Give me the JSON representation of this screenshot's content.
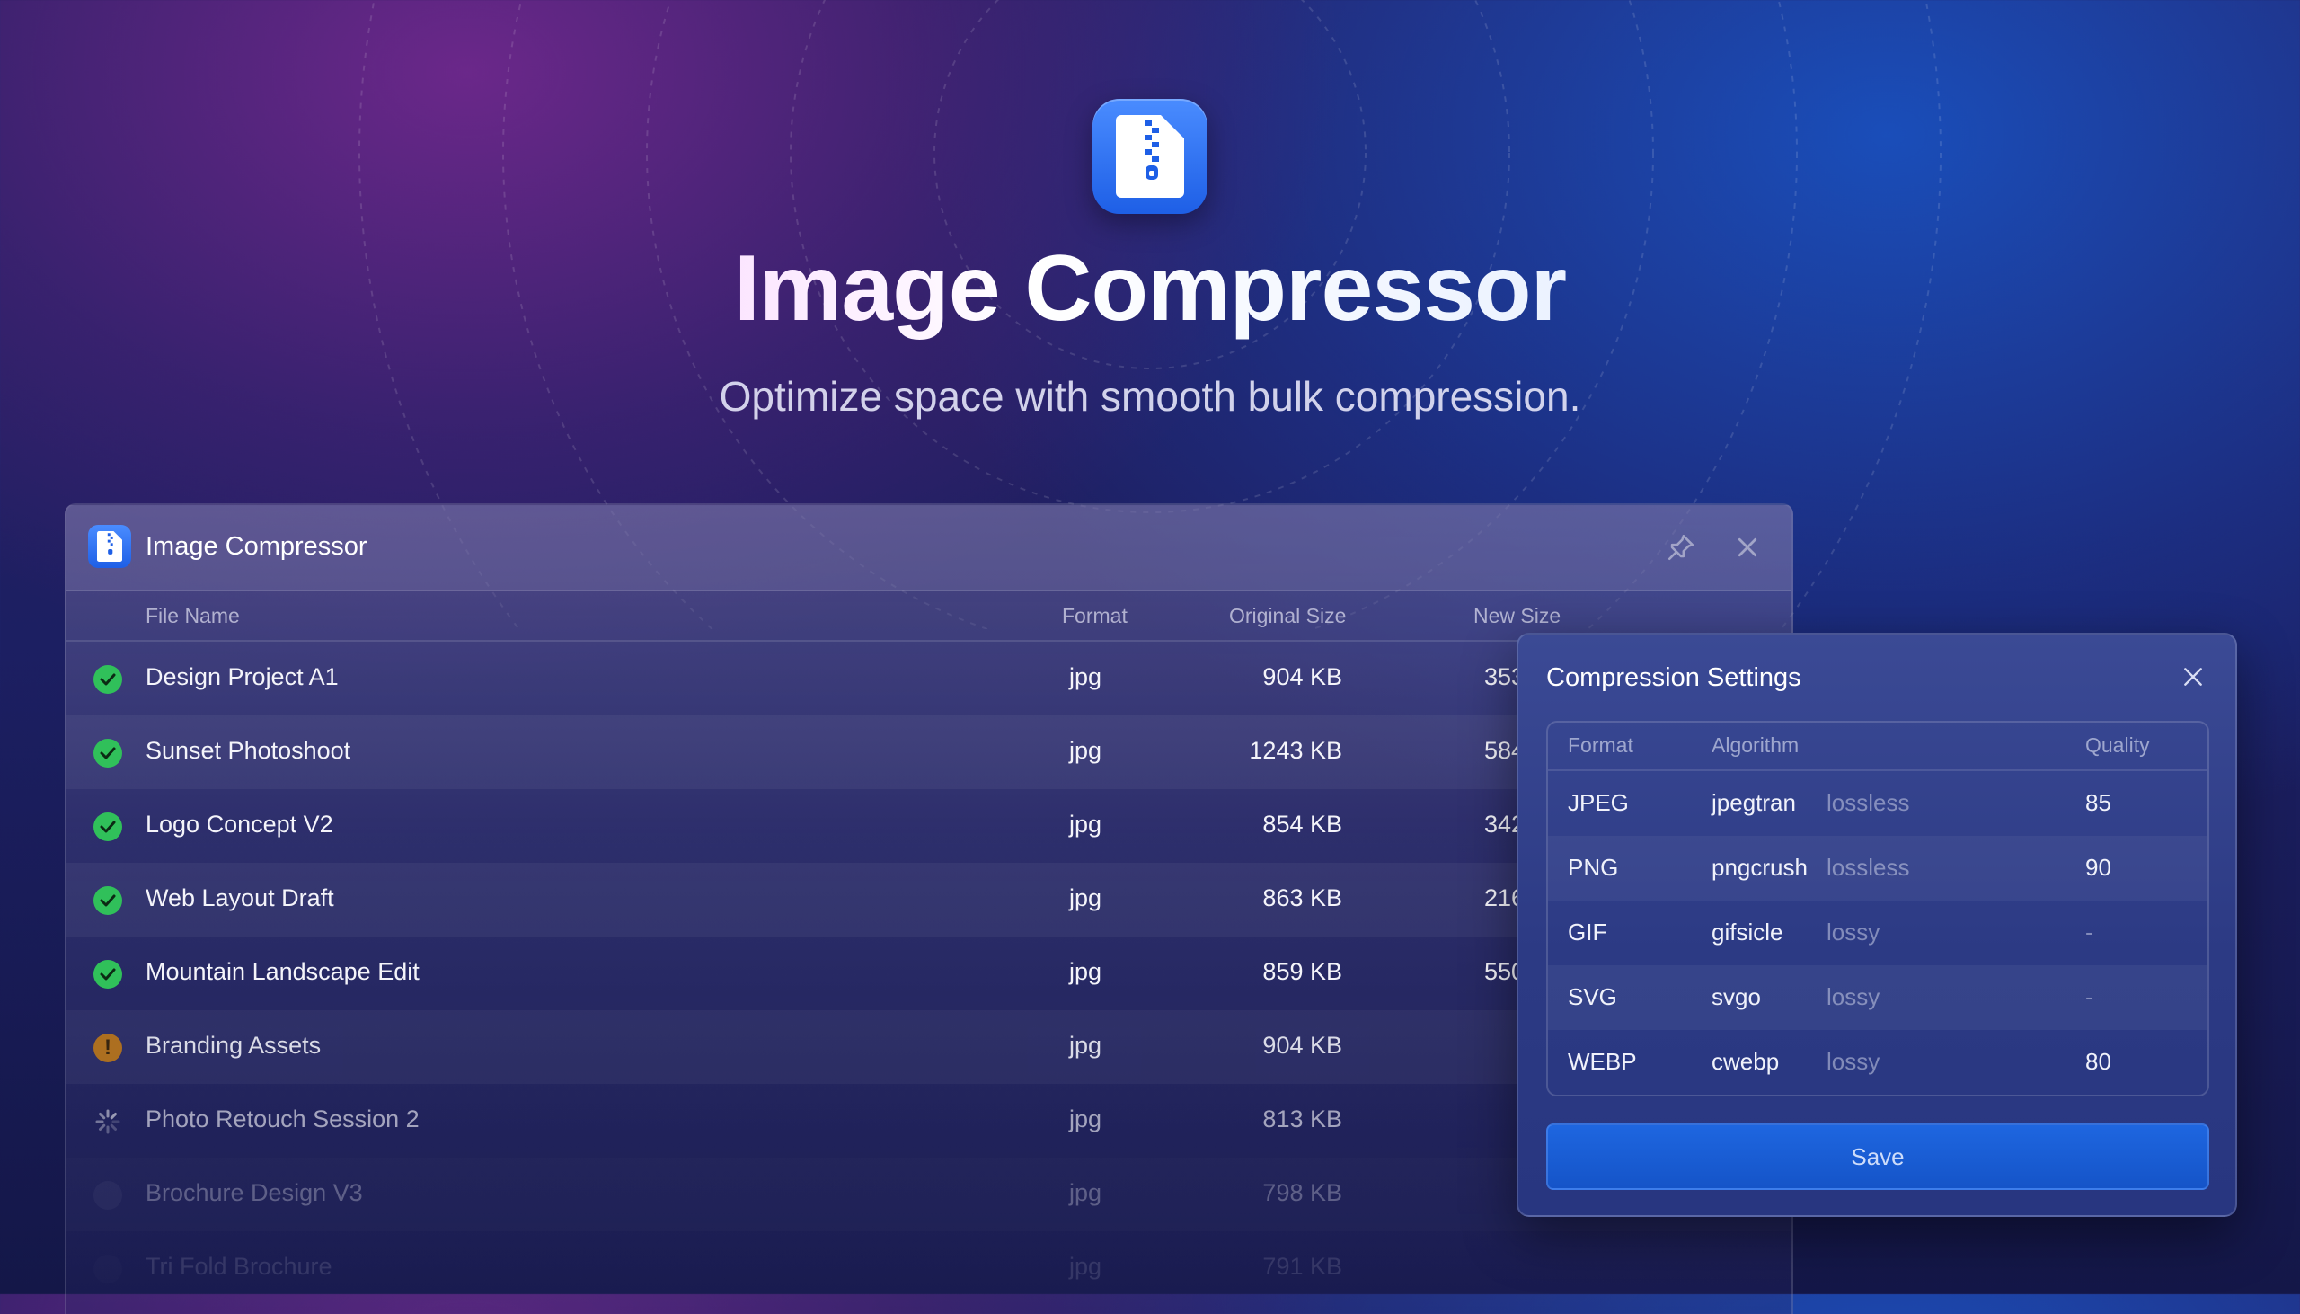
{
  "hero": {
    "title": "Image Compressor",
    "subtitle": "Optimize space with smooth bulk compression."
  },
  "window": {
    "title": "Image Compressor",
    "columns": {
      "file_name": "File Name",
      "format": "Format",
      "original_size": "Original Size",
      "new_size": "New Size"
    },
    "files": [
      {
        "name": "Design Project A1",
        "format": "jpg",
        "original_size": "904 KB",
        "new_size": "353",
        "status": "done"
      },
      {
        "name": "Sunset Photoshoot",
        "format": "jpg",
        "original_size": "1243 KB",
        "new_size": "584",
        "status": "done"
      },
      {
        "name": "Logo Concept V2",
        "format": "jpg",
        "original_size": "854 KB",
        "new_size": "342",
        "status": "done"
      },
      {
        "name": "Web Layout Draft",
        "format": "jpg",
        "original_size": "863 KB",
        "new_size": "216",
        "status": "done"
      },
      {
        "name": "Mountain Landscape Edit",
        "format": "jpg",
        "original_size": "859 KB",
        "new_size": "550",
        "status": "done"
      },
      {
        "name": "Branding Assets",
        "format": "jpg",
        "original_size": "904 KB",
        "new_size": "",
        "status": "warning"
      },
      {
        "name": "Photo Retouch Session 2",
        "format": "jpg",
        "original_size": "813 KB",
        "new_size": "",
        "status": "processing"
      },
      {
        "name": "Brochure Design V3",
        "format": "jpg",
        "original_size": "798 KB",
        "new_size": "",
        "status": "pending"
      },
      {
        "name": "Tri Fold Brochure",
        "format": "jpg",
        "original_size": "791 KB",
        "new_size": "",
        "status": "pending"
      }
    ]
  },
  "settings": {
    "title": "Compression Settings",
    "columns": {
      "format": "Format",
      "algorithm": "Algorithm",
      "quality": "Quality"
    },
    "rows": [
      {
        "format": "JPEG",
        "algorithm": "jpegtran",
        "mode": "lossless",
        "quality": "85"
      },
      {
        "format": "PNG",
        "algorithm": "pngcrush",
        "mode": "lossless",
        "quality": "90"
      },
      {
        "format": "GIF",
        "algorithm": "gifsicle",
        "mode": "lossy",
        "quality": "-"
      },
      {
        "format": "SVG",
        "algorithm": "svgo",
        "mode": "lossy",
        "quality": "-"
      },
      {
        "format": "WEBP",
        "algorithm": "cwebp",
        "mode": "lossy",
        "quality": "80"
      }
    ],
    "save_label": "Save"
  },
  "colors": {
    "accent": "#1e66e0",
    "success": "#30c05a",
    "warning": "#c07a18"
  }
}
